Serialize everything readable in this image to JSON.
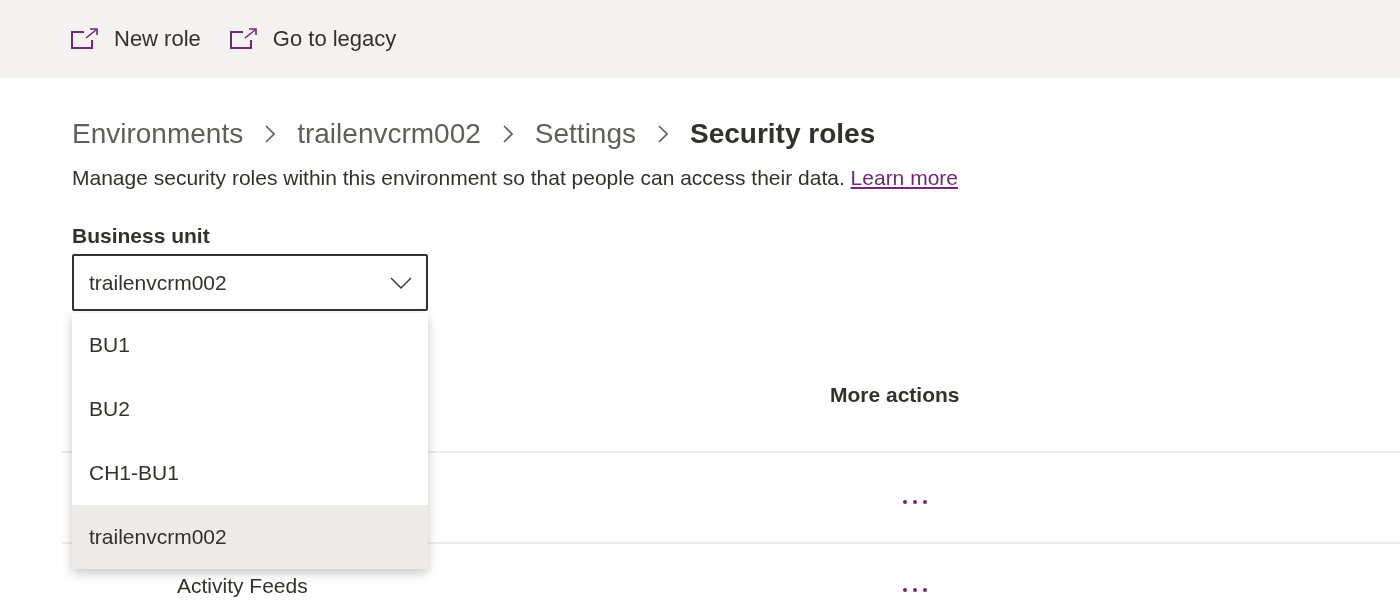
{
  "command_bar": [
    {
      "label": "New role"
    },
    {
      "label": "Go to legacy"
    }
  ],
  "breadcrumb": [
    {
      "label": "Environments",
      "current": false
    },
    {
      "label": "trailenvcrm002",
      "current": false
    },
    {
      "label": "Settings",
      "current": false
    },
    {
      "label": "Security roles",
      "current": true
    }
  ],
  "description": {
    "text": "Manage security roles within this environment so that people can access their data.",
    "link": "Learn more"
  },
  "business_unit": {
    "label": "Business unit",
    "value": "trailenvcrm002",
    "expanded": true,
    "options": [
      {
        "label": "BU1",
        "selected": false
      },
      {
        "label": "BU2",
        "selected": false
      },
      {
        "label": "CH1-BU1",
        "selected": false
      },
      {
        "label": "trailenvcrm002",
        "selected": true
      }
    ]
  },
  "table": {
    "columns": [
      "More actions"
    ],
    "rows": [
      {
        "more_actions": true
      },
      {
        "name": "Activity Feeds",
        "more_actions": true
      }
    ]
  }
}
